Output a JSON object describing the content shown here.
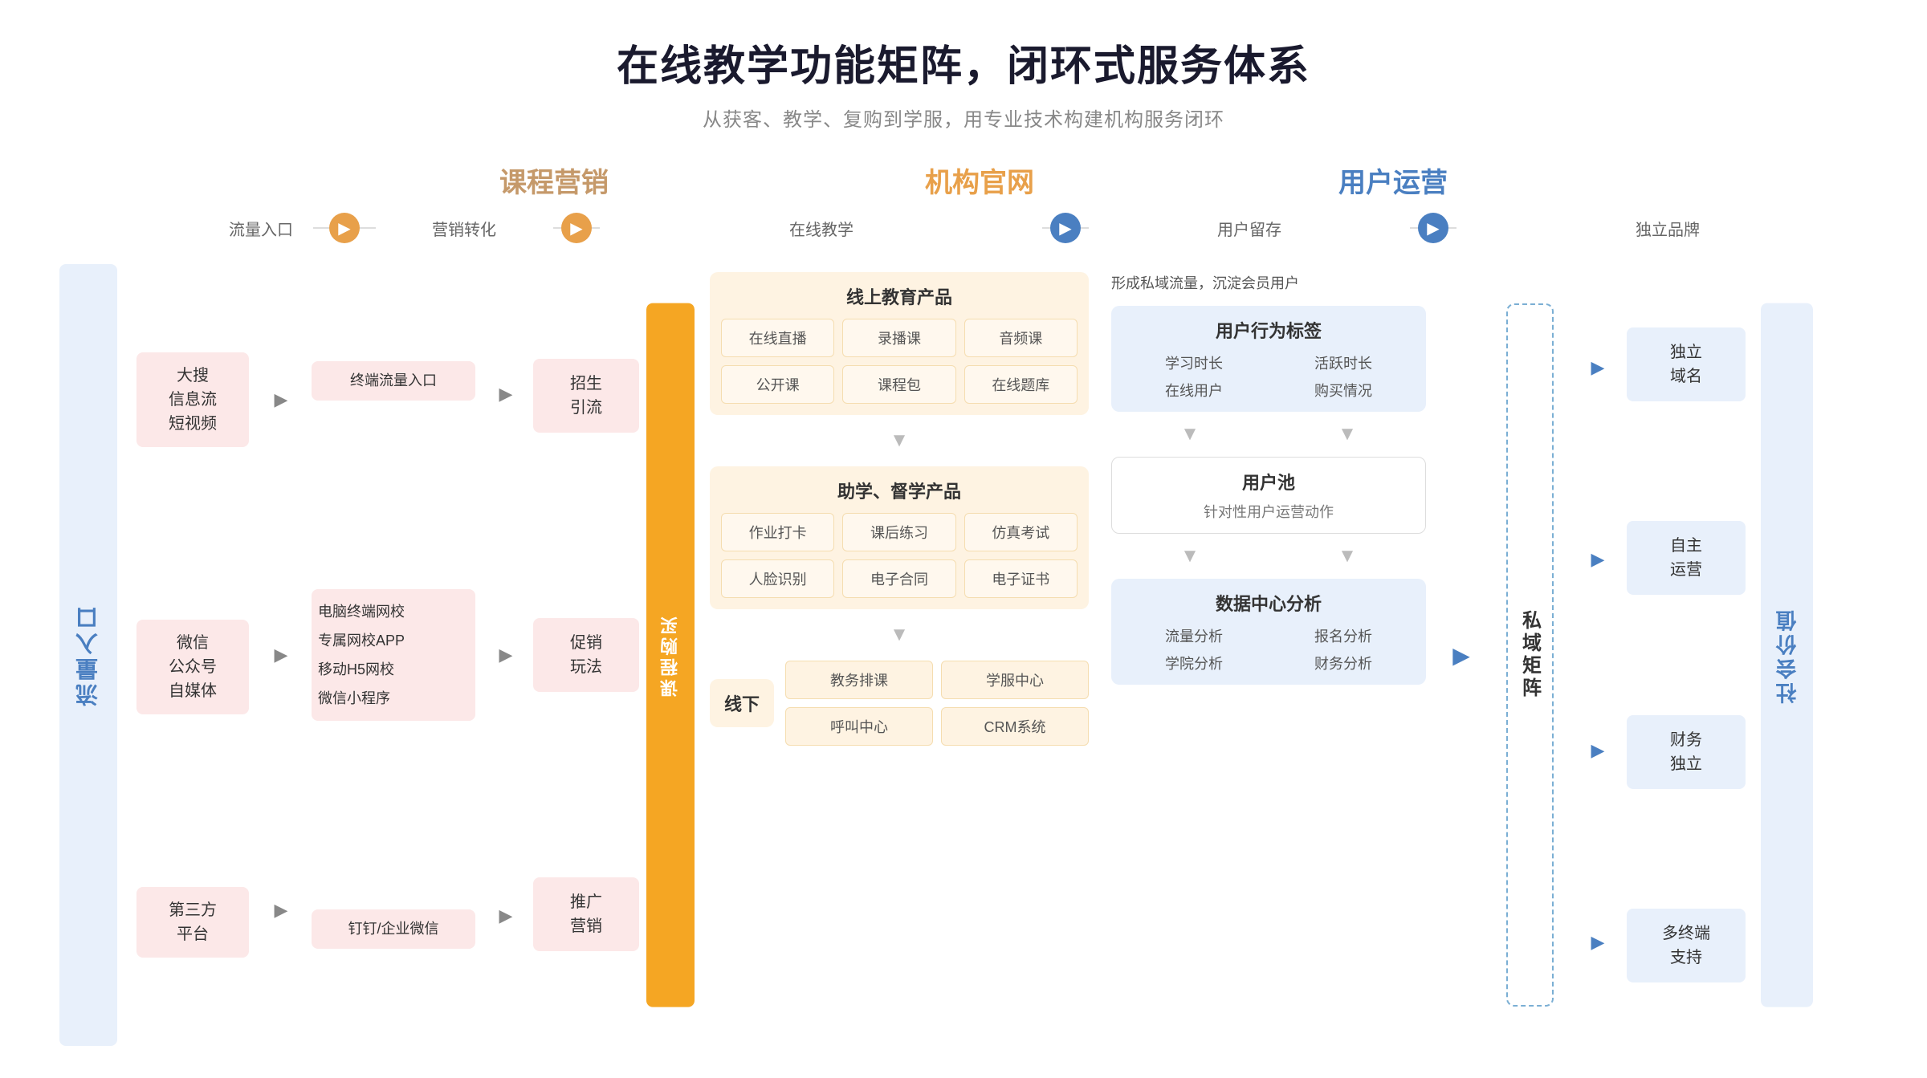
{
  "header": {
    "title": "在线教学功能矩阵，闭环式服务体系",
    "subtitle": "从获客、教学、复购到学服，用专业技术构建机构服务闭环"
  },
  "sections": {
    "marketing": "课程营销",
    "official": "机构官网",
    "userops": "用户运营"
  },
  "flow_steps": {
    "traffic": "流量入口",
    "conversion": "营销转化",
    "online_teaching": "在线教学",
    "user_retention": "用户留存",
    "brand": "独立品牌"
  },
  "left_label": "流量入口",
  "right_label": "社会价值",
  "traffic_boxes": [
    {
      "text": "大搜\n信息流\n短视频"
    },
    {
      "text": "微信\n公众号\n自媒体"
    },
    {
      "text": "第三方\n平台"
    }
  ],
  "marketing_boxes": [
    {
      "text": "终端流量入口"
    },
    {
      "text": "电脑终端网校\n专属网校APP\n移动H5网校\n微信小程序"
    },
    {
      "text": "钉钉/企业微信"
    }
  ],
  "sales_boxes": [
    {
      "text": "招生\n引流"
    },
    {
      "text": "促销\n玩法"
    },
    {
      "text": "推广\n营销"
    }
  ],
  "course_buy_label": "课程购买",
  "online_education": {
    "section1_title": "线上教育产品",
    "items1": [
      "在线直播",
      "录播课",
      "音频课",
      "公开课",
      "课程包",
      "在线题库"
    ],
    "section2_title": "助学、督学产品",
    "items2": [
      "作业打卡",
      "课后练习",
      "仿真考试",
      "人脸识别",
      "电子合同",
      "电子证书"
    ],
    "offline_label": "线下",
    "offline_items": [
      "教务排课",
      "学服中心",
      "呼叫中心",
      "CRM系统"
    ]
  },
  "user_section": {
    "top_text": "形成私域流量，沉淀会员用户",
    "tag_title": "用户行为标签",
    "tag_items": [
      "学习时长",
      "活跃时长",
      "在线用户",
      "购买情况"
    ],
    "pool_title": "用户池",
    "pool_sub": "针对性用户运营动作",
    "data_title": "数据中心分析",
    "data_items": [
      "流量分析",
      "报名分析",
      "学院分析",
      "财务分析"
    ]
  },
  "private_domain": {
    "label": "私域矩阵"
  },
  "brand_boxes": [
    {
      "text": "独立\n域名"
    },
    {
      "text": "自主\n运营"
    },
    {
      "text": "财务\n独立"
    },
    {
      "text": "多终端\n支持"
    }
  ],
  "icons": {
    "arrow_right": "▶",
    "arrow_down": "▼",
    "chevron_right": "›"
  }
}
